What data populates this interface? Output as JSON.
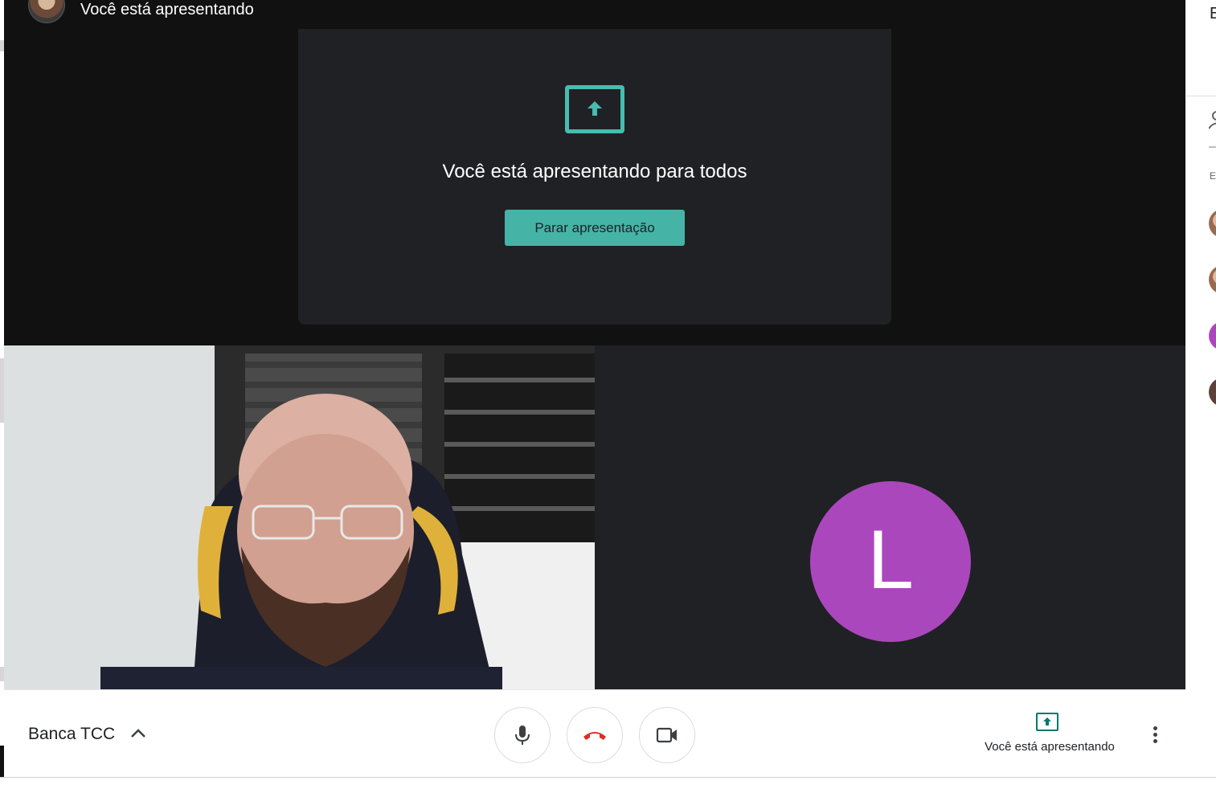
{
  "stage": {
    "presenter_label": "Você está apresentando"
  },
  "presentation_card": {
    "icon": "present-to-all-icon",
    "title": "Você está apresentando para todos",
    "stop_button_label": "Parar apresentação",
    "accent_color": "#46b3a7"
  },
  "tiles": {
    "avatar_initial": "L",
    "avatar_color": "#ab47bc"
  },
  "bottom_bar": {
    "meeting_title": "Banca TCC",
    "presenting_label": "Você está apresentando",
    "hangup_color": "#d93025"
  },
  "right_panel": {
    "letter": "E",
    "small_text": "E"
  }
}
